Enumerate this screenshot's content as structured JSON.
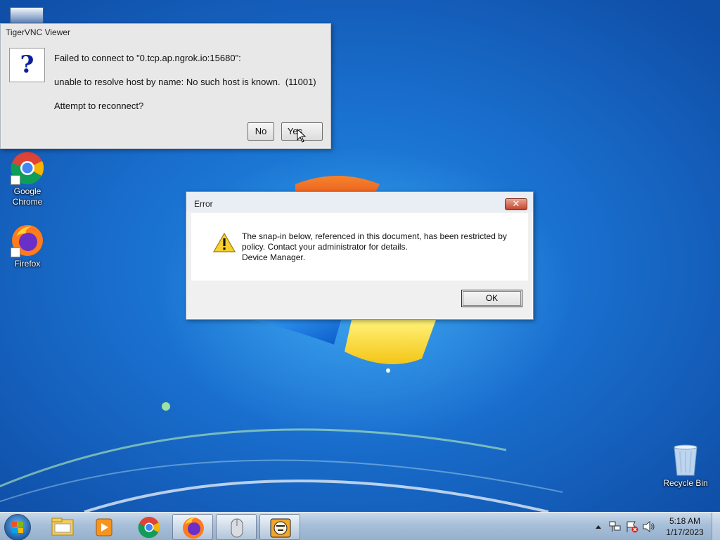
{
  "desktop": {
    "icons": [
      {
        "label": "Google Chrome",
        "icon": "chrome-icon"
      },
      {
        "label": "Firefox",
        "icon": "firefox-icon"
      },
      {
        "label": "Recycle Bin",
        "icon": "recycle-bin-icon"
      }
    ]
  },
  "vnc_dialog": {
    "title": "TigerVNC Viewer",
    "icon": "question-icon",
    "line1": "Failed to connect to \"0.tcp.ap.ngrok.io:15680\":",
    "line2": "unable to resolve host by name: No such host is known.  (11001)",
    "line3": "Attempt to reconnect?",
    "no_label": "No",
    "yes_label": "Yes"
  },
  "error_dialog": {
    "title": "Error",
    "icon": "warning-icon",
    "message_line1": "The snap-in below, referenced in this document, has been restricted by",
    "message_line2": "policy. Contact your administrator for details.",
    "message_line3": "Device Manager.",
    "ok_label": "OK",
    "close_label": "✕"
  },
  "taskbar": {
    "items": [
      "start-button",
      "explorer-icon",
      "media-player-icon",
      "chrome-icon",
      "firefox-icon",
      "mouse-app-icon",
      "tigervnc-icon"
    ],
    "clock": {
      "time": "5:18 AM",
      "date": "1/17/2023"
    },
    "tray_icons": [
      "show-hidden-icons-chevron",
      "network-icon",
      "action-center-flag-icon",
      "volume-icon"
    ]
  },
  "colors": {
    "desktop_blue": "#1a70cf",
    "error_close": "#c4452b"
  }
}
